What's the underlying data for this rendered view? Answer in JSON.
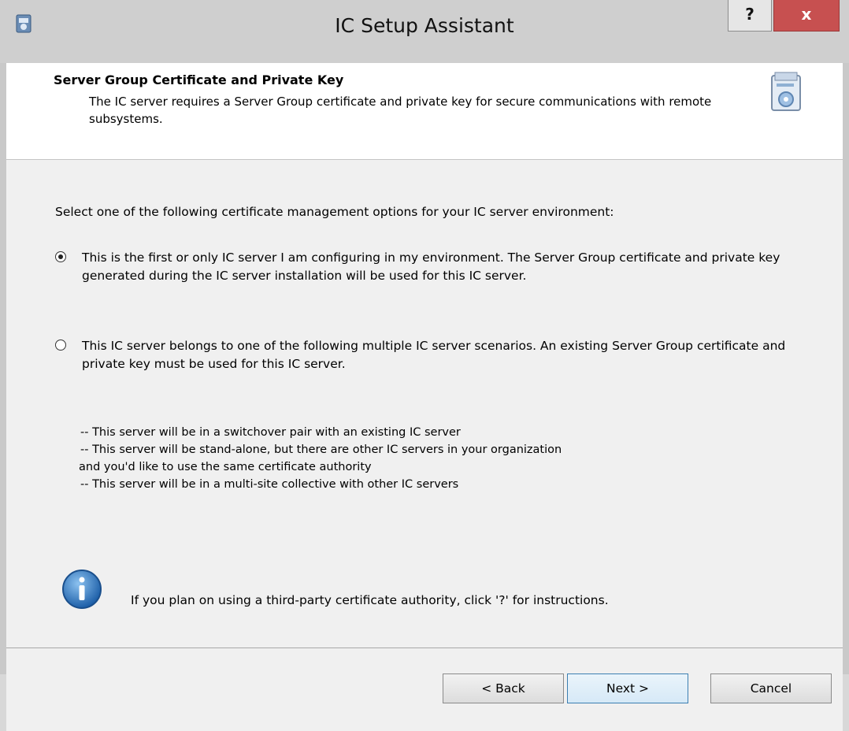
{
  "window": {
    "title": "IC Setup Assistant",
    "help_label": "?",
    "close_label": "x"
  },
  "header": {
    "title": "Server Group Certificate and Private Key",
    "description": "The IC server requires a Server Group certificate and private key for secure communications with remote subsystems."
  },
  "content": {
    "intro": "Select one of the following certificate management options for your IC server environment:",
    "options": [
      {
        "label": "This is the first or only IC server I am configuring in my environment. The Server Group certificate and private key generated during the IC server installation will be used for this IC server.",
        "selected": true
      },
      {
        "label": "This IC server belongs to one of the following multiple IC server scenarios. An existing Server Group certificate and private key must be used for this IC server.",
        "selected": false
      }
    ],
    "scenarios": [
      "-- This server will be in a switchover pair with an existing IC server",
      "-- This server will be stand-alone, but there are other IC servers in your organization",
      "and you'd like to use the same certificate authority",
      "-- This server will be in a multi-site collective with other IC servers"
    ],
    "info": "If you plan on using a third-party certificate authority, click '?' for instructions."
  },
  "buttons": {
    "back": "< Back",
    "next": "Next >",
    "cancel": "Cancel"
  }
}
